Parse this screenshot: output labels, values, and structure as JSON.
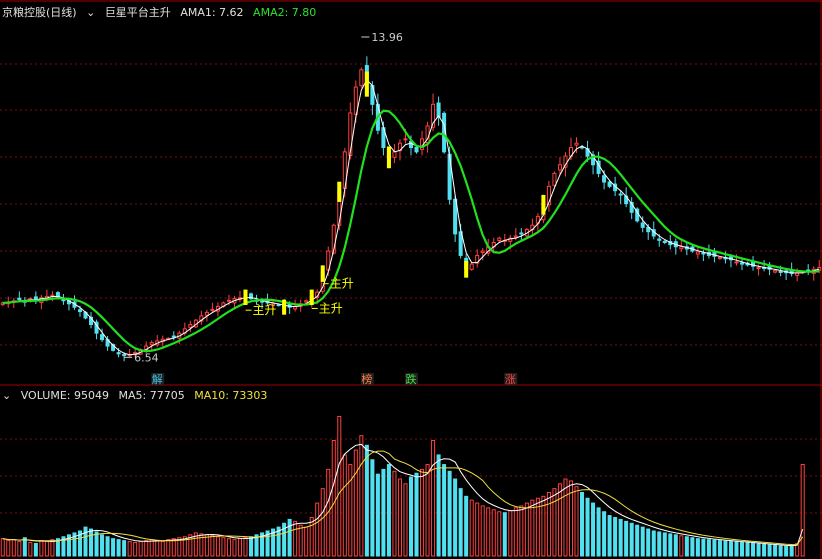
{
  "header": {
    "stock": "京粮控股(日线)",
    "indicator": "巨星平台主升",
    "ama1_label": "AMA1: 7.62",
    "ama2_label": "AMA2: 7.80"
  },
  "volume_header": {
    "volume_label": "VOLUME: 95049",
    "ma5_label": "MA5: 77705",
    "ma10_label": "MA10: 73303"
  },
  "colors": {
    "up": "#ff4040",
    "down": "#50e0f0",
    "ama1": "#ffffff",
    "ama2": "#20e020",
    "signal": "#ffff00"
  },
  "annotations": {
    "high_label": "13.96",
    "low_label": "6.54",
    "zhusheng": "主升",
    "events": [
      "解",
      "榜",
      "跌",
      "涨"
    ]
  },
  "chart_data": [
    {
      "type": "candlestick",
      "title": "京粮控股(日线)",
      "ylim": [
        6.2,
        14.4
      ],
      "close": [
        7.8,
        7.82,
        7.85,
        7.88,
        7.84,
        7.9,
        7.87,
        7.92,
        7.95,
        7.98,
        7.92,
        7.85,
        7.78,
        7.7,
        7.6,
        7.45,
        7.3,
        7.1,
        6.95,
        6.8,
        6.7,
        6.62,
        6.58,
        6.6,
        6.65,
        6.72,
        6.8,
        6.88,
        6.92,
        6.96,
        6.98,
        7.02,
        7.1,
        7.2,
        7.3,
        7.4,
        7.5,
        7.58,
        7.65,
        7.72,
        7.8,
        7.86,
        7.9,
        7.92,
        7.95,
        7.9,
        7.85,
        7.82,
        7.8,
        7.78,
        7.75,
        7.72,
        7.7,
        7.72,
        7.78,
        7.85,
        7.95,
        8.05,
        8.5,
        9.0,
        9.6,
        10.4,
        11.3,
        12.2,
        12.8,
        13.2,
        12.9,
        12.4,
        11.8,
        11.4,
        11.2,
        11.3,
        11.5,
        11.6,
        11.4,
        11.3,
        11.6,
        11.9,
        12.4,
        12.1,
        11.3,
        10.2,
        9.4,
        8.9,
        8.6,
        8.7,
        8.9,
        9.0,
        9.1,
        9.2,
        9.3,
        9.25,
        9.3,
        9.35,
        9.4,
        9.5,
        9.6,
        9.8,
        10.1,
        10.5,
        10.8,
        11.0,
        11.2,
        11.4,
        11.5,
        11.4,
        11.2,
        11.0,
        10.8,
        10.6,
        10.5,
        10.4,
        10.3,
        10.1,
        9.9,
        9.7,
        9.55,
        9.45,
        9.35,
        9.25,
        9.2,
        9.15,
        9.1,
        9.1,
        9.05,
        9.0,
        8.98,
        8.95,
        8.9,
        8.88,
        8.85,
        8.82,
        8.8,
        8.75,
        8.7,
        8.68,
        8.65,
        8.62,
        8.6,
        8.58,
        8.55,
        8.52,
        8.5,
        8.48,
        8.5,
        8.52,
        8.55,
        8.58,
        8.62
      ],
      "high_marker": 13.96,
      "low_marker": 6.54
    },
    {
      "type": "bar",
      "title": "VOLUME",
      "ylim": [
        0,
        160000
      ],
      "values": [
        18000,
        16000,
        17000,
        15000,
        19000,
        14000,
        13000,
        16000,
        15000,
        17000,
        18000,
        20000,
        22000,
        24000,
        26000,
        30000,
        28000,
        25000,
        22000,
        20000,
        18000,
        17000,
        16000,
        15000,
        14000,
        15000,
        16000,
        17000,
        16000,
        15000,
        17000,
        18000,
        19000,
        20000,
        22000,
        24000,
        23000,
        22000,
        21000,
        20000,
        19000,
        18000,
        17000,
        18000,
        19000,
        20000,
        22000,
        24000,
        26000,
        28000,
        30000,
        34000,
        38000,
        36000,
        32000,
        30000,
        40000,
        55000,
        70000,
        90000,
        120000,
        145000,
        105000,
        95000,
        110000,
        125000,
        115000,
        100000,
        85000,
        90000,
        95000,
        88000,
        80000,
        75000,
        82000,
        86000,
        90000,
        95000,
        120000,
        105000,
        95000,
        88000,
        80000,
        70000,
        62000,
        58000,
        55000,
        52000,
        50000,
        48000,
        46000,
        45000,
        47000,
        50000,
        52000,
        55000,
        58000,
        60000,
        62000,
        66000,
        70000,
        75000,
        80000,
        78000,
        72000,
        66000,
        60000,
        55000,
        50000,
        46000,
        42000,
        40000,
        38000,
        36000,
        34000,
        32000,
        30000,
        28000,
        26000,
        25000,
        24000,
        23000,
        22000,
        21000,
        20000,
        19000,
        18000,
        17500,
        17000,
        16500,
        16000,
        15500,
        15000,
        14500,
        14000,
        13500,
        13000,
        12500,
        12000,
        11500,
        11000,
        10500,
        10000,
        11000,
        13000,
        95049
      ]
    }
  ]
}
